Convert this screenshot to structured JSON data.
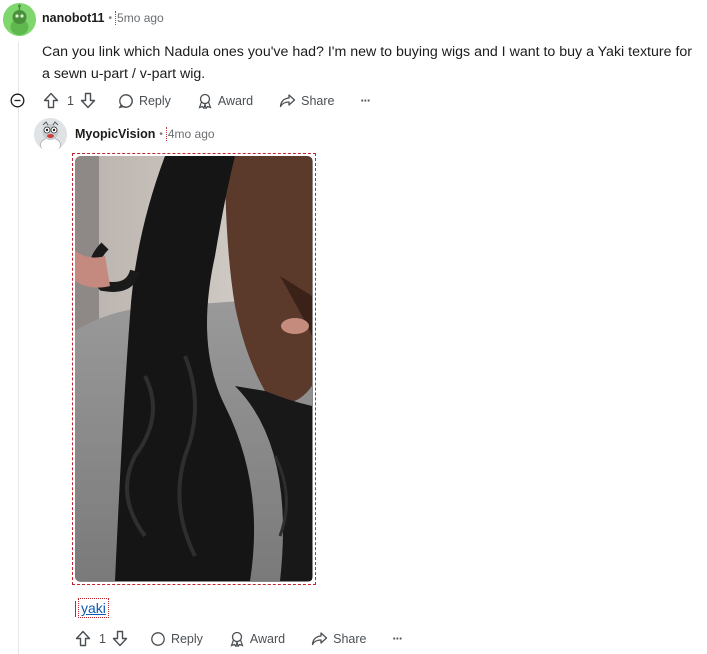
{
  "comment1": {
    "author": "nanobot11",
    "separator": "•",
    "time": "5mo ago",
    "body": "Can you link which Nadula ones you've had? I'm new to buying wigs and I want to buy a Yaki texture for a sewn u-part / v-part wig.",
    "actions": {
      "vote_count": "1",
      "reply": "Reply",
      "award": "Award",
      "share": "Share",
      "more": "···"
    }
  },
  "comment2": {
    "author": "MyopicVision",
    "separator": "•",
    "time": "4mo ago",
    "link_text": "yaki",
    "actions": {
      "vote_count": "1",
      "reply": "Reply",
      "award": "Award",
      "share": "Share",
      "more": "···"
    }
  },
  "icons": [
    "collapse-icon",
    "upvote-icon",
    "downvote-icon",
    "reply-icon",
    "award-icon",
    "share-icon",
    "more-icon"
  ]
}
